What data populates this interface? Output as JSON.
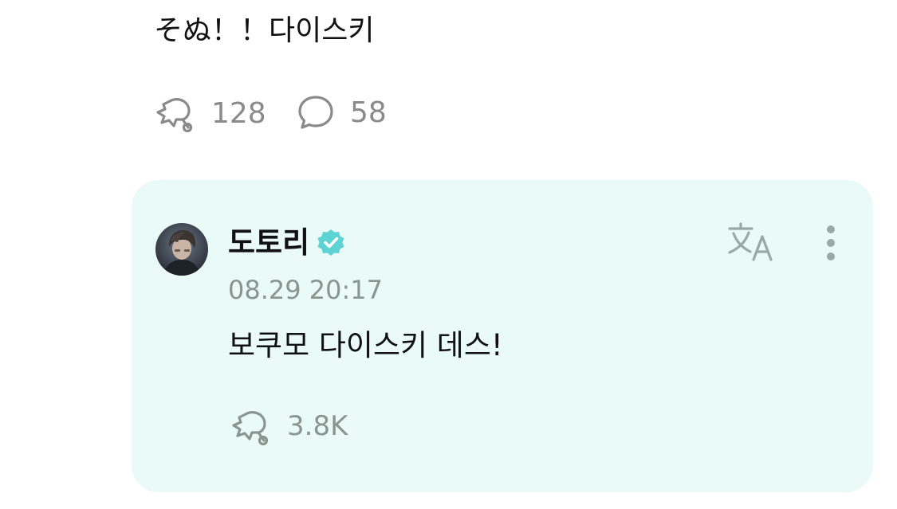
{
  "post": {
    "text": "そぬ！！다이스키",
    "likes": "128",
    "comments": "58"
  },
  "reply": {
    "username": "도토리",
    "timestamp": "08.29 20:17",
    "text": "보쿠모 다이스키 데스!",
    "likes": "3.8K"
  },
  "icons": {
    "like": "like-bubble-icon",
    "comment": "comment-bubble-icon",
    "verified": "verified-badge-icon",
    "translate": "translate-icon",
    "more": "more-vertical-icon"
  },
  "colors": {
    "card_background": "#eafaf6",
    "verified": "#5ed3d3",
    "muted_text": "#8a9590",
    "icon_tint": "#98aaa6"
  }
}
